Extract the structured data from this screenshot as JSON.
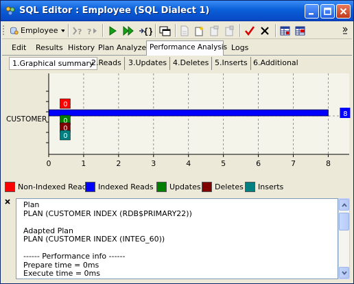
{
  "window": {
    "title": "SQL Editor : Employee (SQL Dialect 1)"
  },
  "toolbar": {
    "database_label": "Employee",
    "icons": [
      "database-icon",
      "dropdown-arrow-icon",
      "help-sql-icon",
      "step-icon",
      "run-icon",
      "run-all-icon",
      "transaction-icon",
      "copy-window-icon",
      "new-blank-icon",
      "new-doc-icon",
      "paste-doc-icon",
      "stamp-doc-icon",
      "commit-icon",
      "rollback-icon",
      "grid-icon",
      "grid-settings-icon",
      "chevron-more-icon"
    ]
  },
  "main_tabs": [
    {
      "label": "Edit",
      "active": false
    },
    {
      "label": "Results",
      "active": false
    },
    {
      "label": "History",
      "active": false
    },
    {
      "label": "Plan Analyzer",
      "active": false
    },
    {
      "label": "Performance Analysis",
      "active": true
    },
    {
      "label": "Logs",
      "active": false
    }
  ],
  "sub_tabs": [
    {
      "label": "1.Graphical summary",
      "active": true
    },
    {
      "label": "2.Reads",
      "active": false
    },
    {
      "label": "3.Updates",
      "active": false
    },
    {
      "label": "4.Deletes",
      "active": false
    },
    {
      "label": "5.Inserts",
      "active": false
    },
    {
      "label": "6.Additional",
      "active": false
    }
  ],
  "chart_data": {
    "type": "bar",
    "orientation": "horizontal",
    "categories": [
      "CUSTOMER"
    ],
    "series": [
      {
        "name": "Non-Indexed Reads",
        "color": "#ff0000",
        "values": [
          0
        ]
      },
      {
        "name": "Indexed Reads",
        "color": "#0000ff",
        "values": [
          8
        ]
      },
      {
        "name": "Updates",
        "color": "#008000",
        "values": [
          0
        ]
      },
      {
        "name": "Deletes",
        "color": "#800000",
        "values": [
          0
        ]
      },
      {
        "name": "Inserts",
        "color": "#008080",
        "values": [
          0
        ]
      }
    ],
    "x_ticks": [
      "0",
      "1",
      "2",
      "3",
      "4",
      "5",
      "6",
      "7",
      "8"
    ],
    "xlim": [
      0,
      8.6
    ],
    "grid": true,
    "legend_position": "bottom"
  },
  "plan_text": {
    "lines": [
      "Plan",
      "PLAN (CUSTOMER INDEX (RDB$PRIMARY22))",
      "",
      "Adapted Plan",
      "PLAN (CUSTOMER INDEX (INTEG_60))",
      "",
      "------ Performance info ------",
      "Prepare time = 0ms",
      "Execute time = 0ms"
    ]
  }
}
